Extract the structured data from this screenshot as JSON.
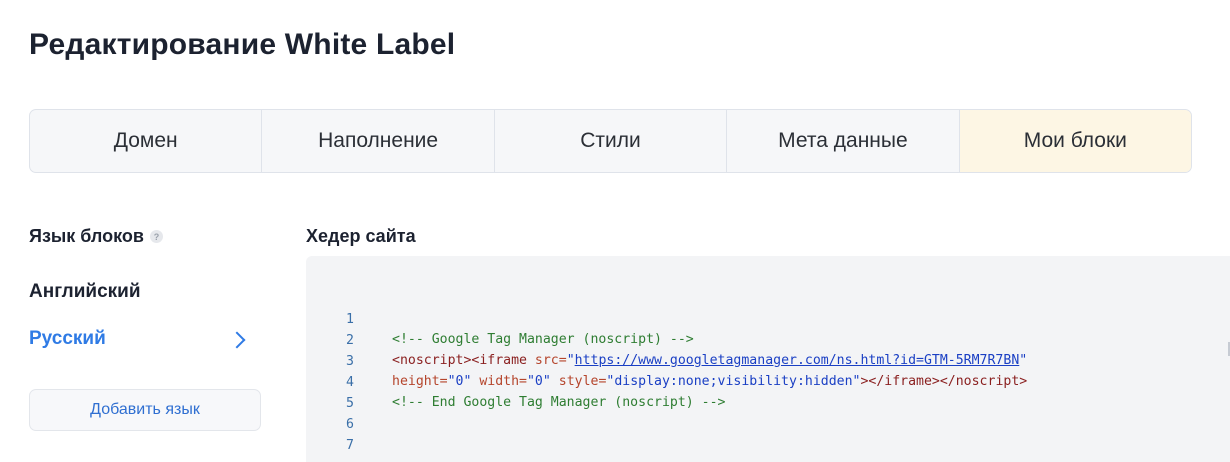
{
  "page": {
    "title": "Редактирование White Label"
  },
  "tabs": [
    {
      "label": "Домен",
      "active": false
    },
    {
      "label": "Наполнение",
      "active": false
    },
    {
      "label": "Стили",
      "active": false
    },
    {
      "label": "Мета данные",
      "active": false
    },
    {
      "label": "Мои блоки",
      "active": true
    }
  ],
  "sidebar": {
    "label": "Язык блоков",
    "help_icon": "question-mark-icon",
    "languages": [
      {
        "label": "Английский",
        "selected": false
      },
      {
        "label": "Русский",
        "selected": true
      }
    ],
    "add_button": "Добавить язык"
  },
  "editor": {
    "title": "Хедер сайта",
    "line_numbers": [
      "1",
      "2",
      "3",
      "4",
      "5",
      "6",
      "7"
    ],
    "lines": {
      "l1": "<!-- Google Tag Manager (noscript) -->",
      "l2_open": "<noscript><iframe ",
      "l2_attr": "src=",
      "l2_q1": "\"",
      "l2_url": "https://www.googletagmanager.com/ns.html?id=GTM-5RM7R7BN",
      "l2_q2": "\"",
      "l3_a1": "height=",
      "l3_v1": "\"0\"",
      "l3_a2": " width=",
      "l3_v2": "\"0\"",
      "l3_a3": " style=",
      "l3_v3": "\"display:none;visibility:hidden\"",
      "l3_close": "></iframe></noscript>",
      "l4": "<!-- End Google Tag Manager (noscript) -->"
    }
  },
  "colors": {
    "accent": "#2f7be5",
    "active_tab_bg": "#fdf6e4",
    "editor_bg": "#f3f4f6",
    "comment": "#2e7d32",
    "tag": "#8a1f1f",
    "attr": "#b5452c",
    "value": "#1a3fc4"
  }
}
